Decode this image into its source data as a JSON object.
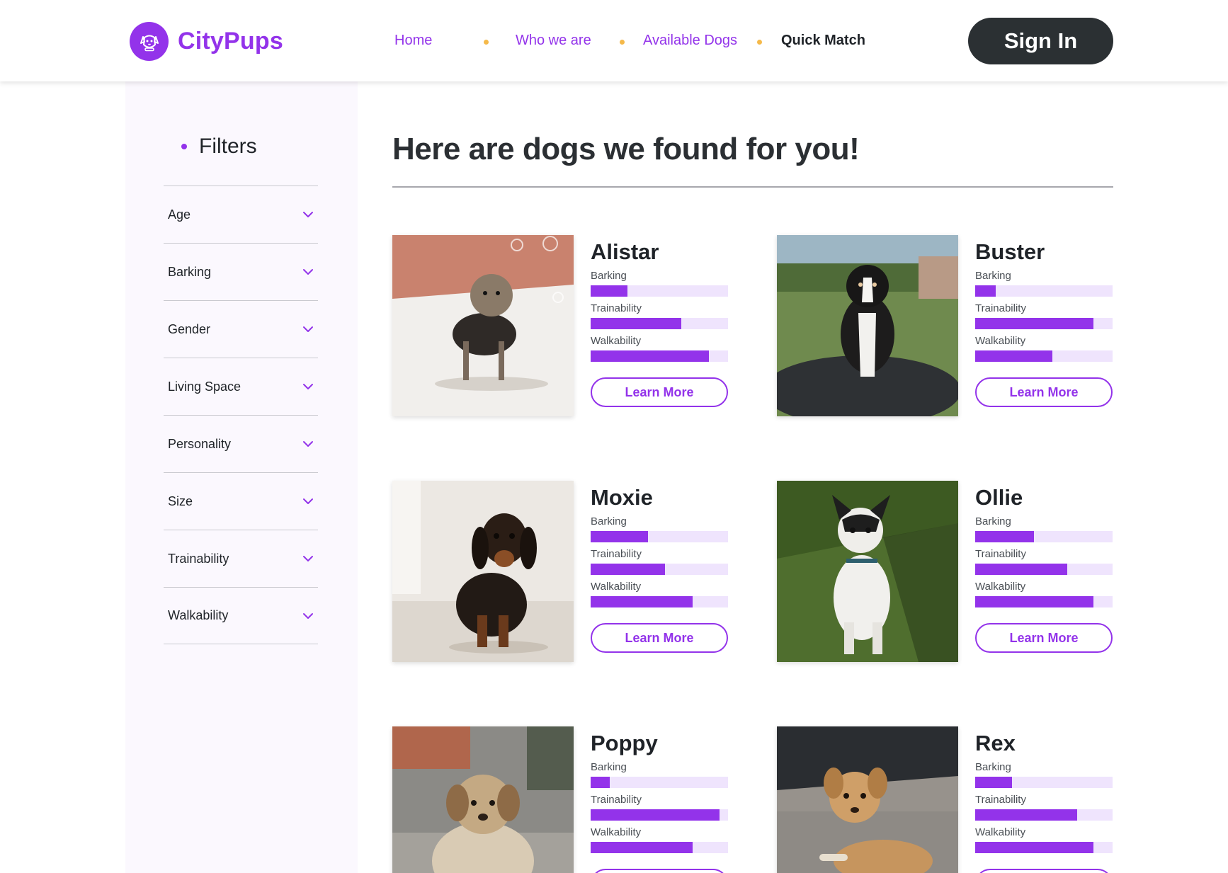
{
  "brand": {
    "name": "CityPups",
    "logo_icon": "dog-face-icon"
  },
  "nav": {
    "links": [
      {
        "label": "Home",
        "active": false
      },
      {
        "label": "Who we are",
        "active": false
      },
      {
        "label": "Available Dogs",
        "active": false
      },
      {
        "label": "Quick Match",
        "active": true
      }
    ],
    "signin_label": "Sign In"
  },
  "filters": {
    "title": "Filters",
    "items": [
      "Age",
      "Barking",
      "Gender",
      "Living Space",
      "Personality",
      "Size",
      "Trainability",
      "Walkability"
    ],
    "expand_icon": "chevron-down-icon"
  },
  "main": {
    "title": "Here are dogs we found for you!"
  },
  "stat_labels": [
    "Barking",
    "Trainability",
    "Walkability"
  ],
  "learn_more_label": "Learn More",
  "dogs": [
    {
      "name": "Alistar",
      "barking": 0.27,
      "trainability": 0.66,
      "walkability": 0.86
    },
    {
      "name": "Buster",
      "barking": 0.15,
      "trainability": 0.86,
      "walkability": 0.56
    },
    {
      "name": "Moxie",
      "barking": 0.42,
      "trainability": 0.54,
      "walkability": 0.74
    },
    {
      "name": "Ollie",
      "barking": 0.43,
      "trainability": 0.67,
      "walkability": 0.86
    },
    {
      "name": "Poppy",
      "barking": 0.14,
      "trainability": 0.94,
      "walkability": 0.74
    },
    {
      "name": "Rex",
      "barking": 0.27,
      "trainability": 0.74,
      "walkability": 0.86
    }
  ],
  "colors": {
    "accent": "#9333ea",
    "bar_track": "#efe4fd",
    "nav_dot": "#f5b94a",
    "signin_bg": "#2b3033"
  }
}
